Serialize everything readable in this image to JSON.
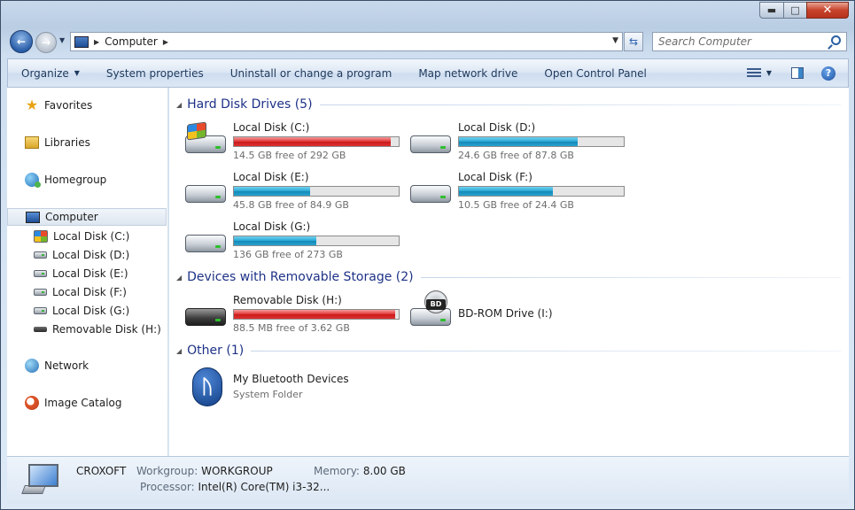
{
  "address": {
    "location": "Computer",
    "search_placeholder": "Search Computer"
  },
  "toolbar": {
    "organize": "Organize",
    "system_properties": "System properties",
    "uninstall": "Uninstall or change a program",
    "map_drive": "Map network drive",
    "control_panel": "Open Control Panel"
  },
  "nav": {
    "favorites": "Favorites",
    "libraries": "Libraries",
    "homegroup": "Homegroup",
    "computer": "Computer",
    "computer_items": [
      {
        "label": "Local Disk (C:)",
        "icon": "windows-drive-icon"
      },
      {
        "label": "Local Disk (D:)",
        "icon": "hard-drive-icon"
      },
      {
        "label": "Local Disk (E:)",
        "icon": "hard-drive-icon"
      },
      {
        "label": "Local Disk (F:)",
        "icon": "hard-drive-icon"
      },
      {
        "label": "Local Disk (G:)",
        "icon": "hard-drive-icon"
      },
      {
        "label": "Removable Disk (H:)",
        "icon": "removable-drive-icon"
      }
    ],
    "network": "Network",
    "image_catalog": "Image Catalog"
  },
  "sections": {
    "hdd": "Hard Disk Drives (5)",
    "removable": "Devices with Removable Storage (2)",
    "other": "Other (1)"
  },
  "drives": [
    {
      "name": "Local Disk (C:)",
      "free_text": "14.5 GB free of 292 GB",
      "used_fraction": 0.95,
      "status": "low"
    },
    {
      "name": "Local Disk (D:)",
      "free_text": "24.6 GB free of 87.8 GB",
      "used_fraction": 0.72,
      "status": "ok"
    },
    {
      "name": "Local Disk (E:)",
      "free_text": "45.8 GB free of 84.9 GB",
      "used_fraction": 0.46,
      "status": "ok"
    },
    {
      "name": "Local Disk (F:)",
      "free_text": "10.5 GB free of 24.4 GB",
      "used_fraction": 0.57,
      "status": "ok"
    },
    {
      "name": "Local Disk (G:)",
      "free_text": "136 GB free of 273 GB",
      "used_fraction": 0.5,
      "status": "ok"
    }
  ],
  "removable": [
    {
      "name": "Removable Disk (H:)",
      "free_text": "88.5 MB free of 3.62 GB",
      "used_fraction": 0.98,
      "status": "low"
    },
    {
      "name": "BD-ROM Drive (I:)",
      "badge": "BD"
    }
  ],
  "other": {
    "name": "My Bluetooth Devices",
    "subtitle": "System Folder"
  },
  "details": {
    "computer_name": "CROXOFT",
    "workgroup_label": "Workgroup:",
    "workgroup": "WORKGROUP",
    "memory_label": "Memory:",
    "memory": "8.00 GB",
    "processor_label": "Processor:",
    "processor": "Intel(R) Core(TM) i3-32..."
  }
}
